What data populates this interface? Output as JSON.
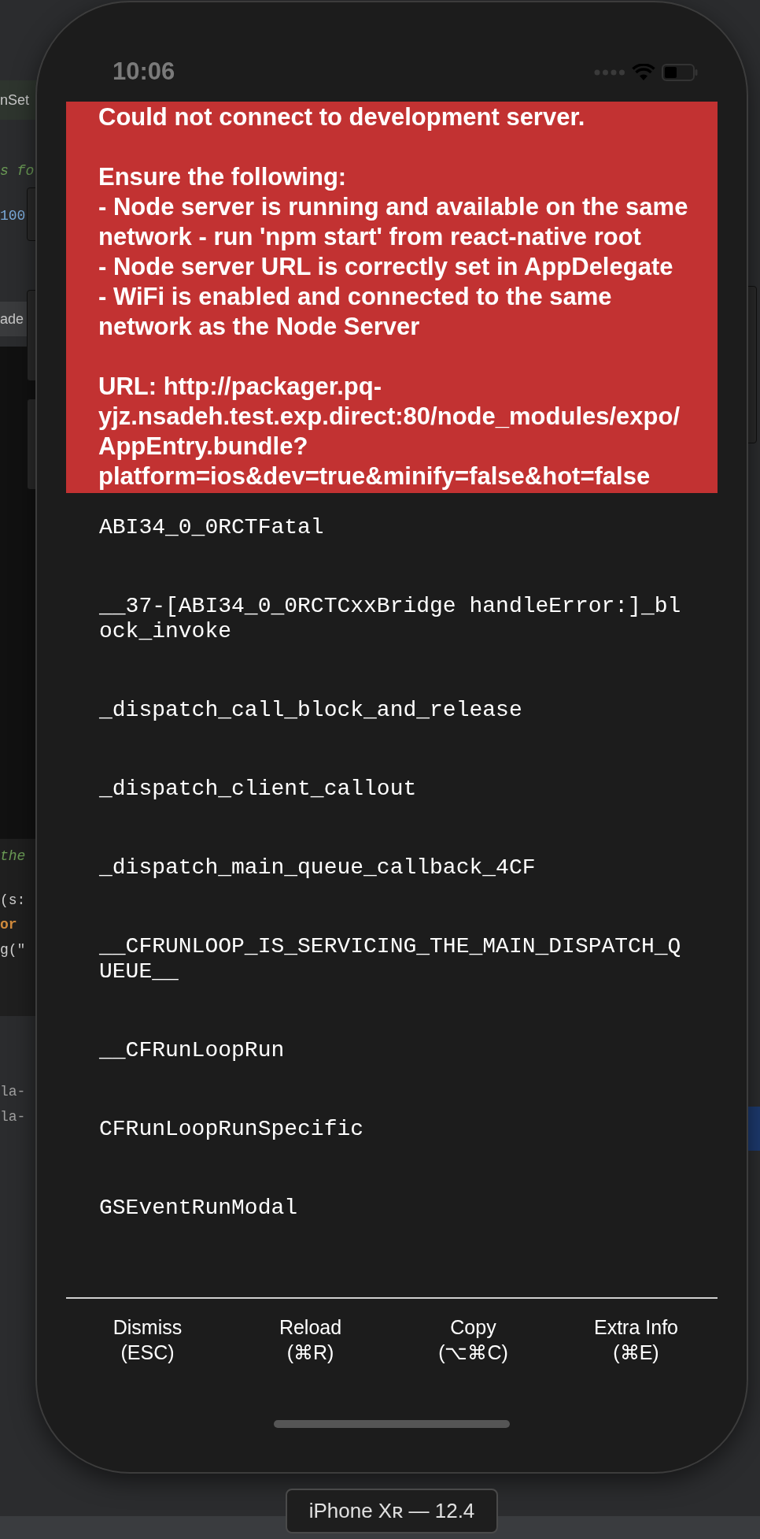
{
  "background_editor": {
    "fragments": [
      {
        "kind": "tab",
        "text": "nSet"
      },
      {
        "kind": "comment",
        "text": "s fo"
      },
      {
        "kind": "number",
        "text": "100"
      },
      {
        "kind": "tab",
        "text": "ade"
      },
      {
        "kind": "comment",
        "text": "the"
      },
      {
        "kind": "code",
        "text": "(s:"
      },
      {
        "kind": "keyword",
        "text": "or"
      },
      {
        "kind": "code",
        "text": "g(\""
      },
      {
        "kind": "log",
        "text": "la-"
      },
      {
        "kind": "log",
        "text": "la-"
      }
    ]
  },
  "status_bar": {
    "time": "10:06"
  },
  "error": {
    "title": "Could not connect to development server.",
    "heading": "Ensure the following:",
    "items": [
      "- Node server is running and available on the same network - run 'npm start' from react-native root",
      "- Node server URL is correctly set in AppDelegate",
      "- WiFi is enabled and connected to the same network as the Node Server"
    ],
    "url": "URL: http://packager.pq-yjz.nsadeh.test.exp.direct:80/node_modules/expo/AppEntry.bundle?platform=ios&dev=true&minify=false&hot=false"
  },
  "stack_frames": [
    "ABI34_0_0RCTFatal",
    "__37-[ABI34_0_0RCTCxxBridge handleError:]_block_invoke",
    "_dispatch_call_block_and_release",
    "_dispatch_client_callout",
    "_dispatch_main_queue_callback_4CF",
    "__CFRUNLOOP_IS_SERVICING_THE_MAIN_DISPATCH_QUEUE__",
    "__CFRunLoopRun",
    "CFRunLoopRunSpecific",
    "GSEventRunModal"
  ],
  "buttons": [
    {
      "label": "Dismiss",
      "shortcut": "(ESC)"
    },
    {
      "label": "Reload",
      "shortcut": "(⌘R)"
    },
    {
      "label": "Copy",
      "shortcut": "(⌥⌘C)"
    },
    {
      "label": "Extra Info",
      "shortcut": "(⌘E)"
    }
  ],
  "device_label": "iPhone Xʀ — 12.4"
}
